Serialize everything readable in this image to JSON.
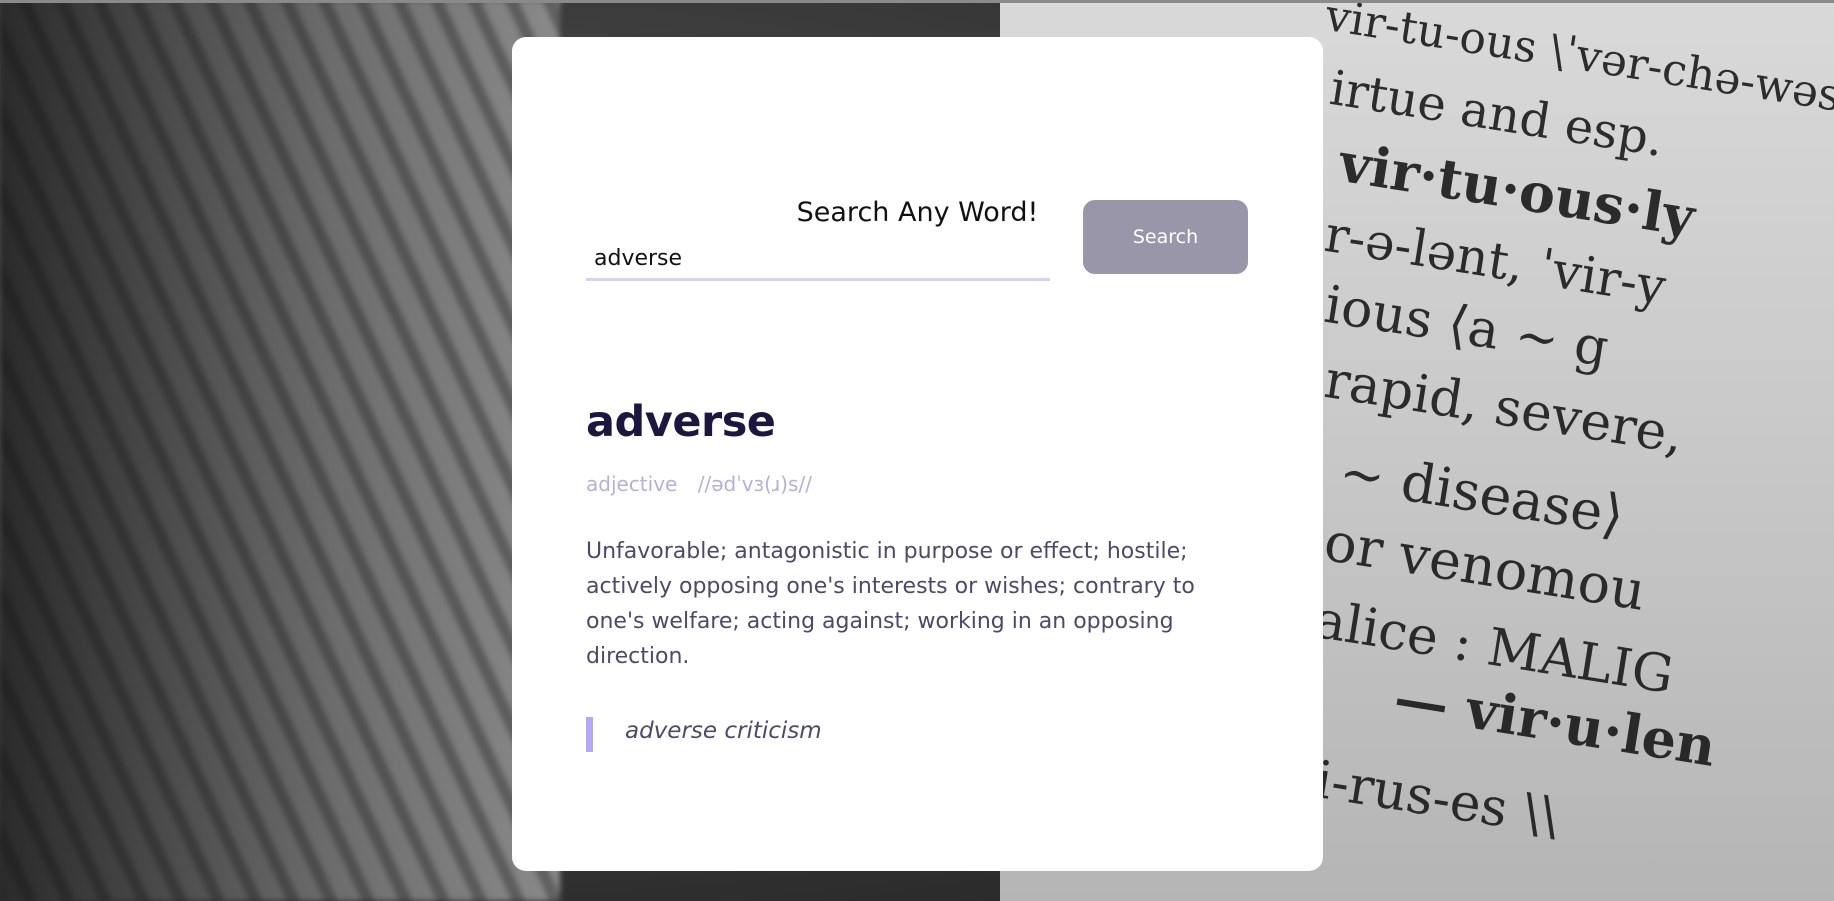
{
  "search": {
    "title": "Search Any Word!",
    "input_value": "adverse",
    "button_label": "Search"
  },
  "entry": {
    "word": "adverse",
    "part_of_speech": "adjective",
    "phonetic": "//ədˈvɜ(ɹ)s//",
    "definition": "Unfavorable; antagonistic in purpose or effect; hostile; actively opposing one's interests or wishes; contrary to one's welfare; acting against; working in an opposing direction.",
    "example": "adverse criticism"
  },
  "colors": {
    "button_bg": "#9896a8",
    "word": "#1d1740",
    "meta": "#b5b1d6",
    "body_text": "#4d4a68",
    "example_bar": "#b3a8f4",
    "input_underline": "#d6d3ea"
  }
}
